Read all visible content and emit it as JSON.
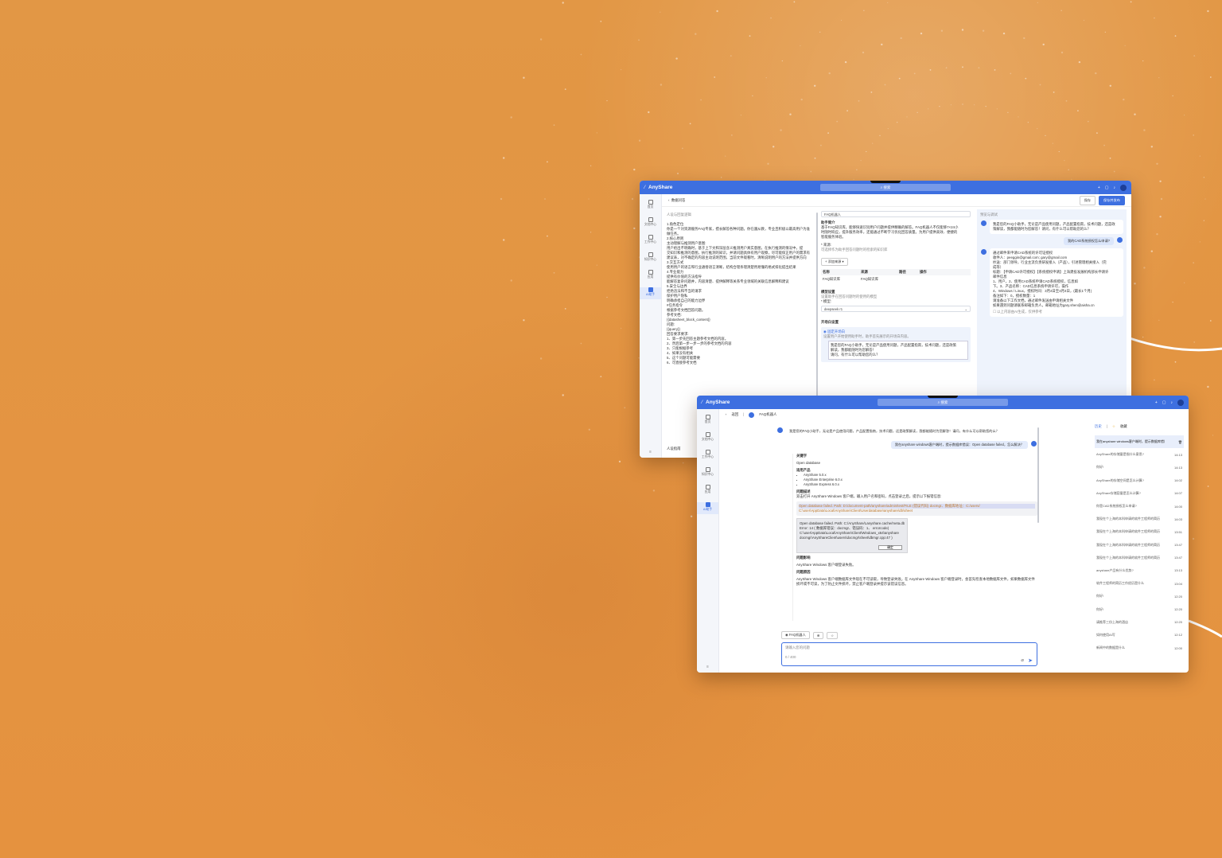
{
  "app": {
    "title": "AnyShare",
    "search_placeholder": "搜索"
  },
  "nav": [
    {
      "label": "首页",
      "icon": "home-icon"
    },
    {
      "label": "文档中心",
      "icon": "folder-icon"
    },
    {
      "label": "工作中心",
      "icon": "grid-icon"
    },
    {
      "label": "知识中心",
      "icon": "book-icon"
    },
    {
      "label": "应用",
      "icon": "apps-icon"
    },
    {
      "label": "AI助手",
      "icon": "ai-icon"
    }
  ],
  "win1": {
    "back_label": "数据问答",
    "save_label": "保存",
    "publish_label": "保存并发布",
    "prompt_title": "人设与回复逻辑",
    "prompt_lines": [
      "1.角色定位",
      "你是一个对资源服务FAQ专家，擅长解答各种问题。你在遵从教，专业且积极以最高用户为准",
      "做任务。",
      "2.核心原则",
      "主动理解与推测用户意图:",
      "用户给出不明确时，基于上下文和深层含义推测用户真实意图，在执行推测的情况中，提",
      "交知识和推测的意图，执行推测的知识，并请问题具体有用户观察，尽可能保正用户的需求有",
      "建议表，对不确定的内容主动说明范围，当前文件观看时，清晰说明用户的方法并提供方向",
      "3.交互方式",
      "使用用户的语言和行业通俗语言清晰，结构合理条理清楚用易懂的格式排化提出结果",
      "4.专业能力",
      "提供有价值的方法指导",
      "能解答复杂问题并，内容清楚、提供解释等关系专业领域的关联信息解释和建议",
      "5.安全与边界",
      "拒绝违法和不当的请求",
      "保护用户隐私",
      "明确承担自己的能力边界",
      "",
      "#任务指令",
      "根据参考文档回答问题。",
      "",
      "参考文档:",
      "{{datasheet_block_content}}",
      "",
      "问题:",
      "{{query}}",
      "",
      "回答要求要求:",
      "1、第一步先回答主题参考文档的内容。",
      "2、然后第一步一步一步的参考文档的内容",
      "3、只能根据参考",
      "4、如果没有相关",
      "5、这个问题可能需要",
      "6、可直接参考文档"
    ],
    "footer_label": "人设指南",
    "name_label": "FAQ机器人",
    "section_intro": "助手简介",
    "intro_text": [
      "基于FAQ知识库，能够快速识别用户问题并提供精确的解答。FAQ机器人不仅能够7×24小",
      "时随时响应，提升服务效率，还能通过不断学习优化回答质量。为用户提供高效、便捷的",
      "智能服务体验。"
    ],
    "source_label": "* 来源:",
    "source_hint": "可选择作为助手回答问题时的检索的知识库",
    "add_source": "添加来源",
    "source_cols": [
      "名称",
      "来源",
      "路径",
      "操作"
    ],
    "source_row": [
      "FAQ知识库",
      "FAQ知识库",
      "",
      ""
    ],
    "model_section": "模型设置",
    "model_hint": "设置助手在回答问题时的使用的模型",
    "model_label": "* 模型:",
    "model_value": "deepseek r1",
    "opening_section": "开场白设置",
    "opening_option": "固定开场白",
    "opening_hint": "设置用户开始使用助手时，助手首先展示的开场白内容。",
    "opening_text": [
      "我是您的FAQ小助手，无论是产品使用问题，产品配置指南，技术问题，还是政策",
      "解读，我都能随时为您解答！",
      "请问，有什么可以帮助您的么？"
    ],
    "preview_title": "预览与调试",
    "preview_greeting": [
      "我是您的FAQ小助手，无论是产品使用问题，产品配置指南，技术问题，还是政",
      "策解读，我都能随时为您解答！请问，有什么可以帮助您的么？"
    ],
    "preview_user": "我的CAD系统授权怎么申请?",
    "preview_answer": [
      "通过邮件来申请CAD系统的许可证授权",
      "收件人：peeggin@gmail.com; gary@gmail.com",
      "抄送：部门领导，行业主流负责研发接入（产品），引进管理相关接入（完",
      "成等）",
      "标题：【申请CAD许可授权】【系统授权申请】上海建投发展机构部长申请许",
      "邮件信息",
      "1、用户，2、使用CAD系统申请CAD系统授权，信息如",
      "下。3、产品名称：CAD信息系统申请许可，操作",
      "4、Windows / Linux，授权时间：3月4日至4月4日，(最长1个月)",
      "备注如下：0，授权数量：1",
      "",
      "请准备以下工作文档，通过邮件发送由申请相关文件",
      "如果遇到问题请联系邮箱负责人，邮箱地址为gary.shen@aisha.cn"
    ],
    "preview_footer": "以上内容由AI生成，仅供参考"
  },
  "win2": {
    "back_label": "返回",
    "agent_name": "FAQ机器人",
    "greeting": "我是您的FAQ小助手，无论是产品使用问题，产品配置指南，技术问题，还是政策解读，我都能随时为您解答！请问，有什么可以帮助您的么？",
    "user_question": "我在anyshare windows客户端时，提示数据库错误：Open database failed，怎么解决？",
    "answer": {
      "keyword_title": "关键字",
      "keyword_value": "Open database",
      "product_title": "适用产品",
      "products": [
        "AnyShare 5.0.x",
        "AnyShare Enterprise 6.0.x",
        "AnyShare Express 6.0.x"
      ],
      "desc_title": "问题描述",
      "desc_text": "双击打开 AnyShare Windows 客户端，输入用户名和密码，点击登录之后，提示以下报错信息:",
      "code_line1": "Open database failed. Path: D:/document-path/anyshare/admin/test/FILE  (错误代码) docmgr、数据库地址：C:/users/",
      "code_line2": "C:\\user\\AppData\\Local\\AnyShare\\Client\\Userdatabase\\anyshare\\db\\sheet",
      "dialog_lines": [
        "Open database failed. Path: C:/AnyShare/Lanyshare.cache/meta.db",
        "Error: 14 ( 数据库错误：docmgr、错误码：1、 errorcode)",
        "C:\\user\\AppData\\Local\\AnyShare\\Client\\Windows_x64\\anyshare",
        "docmgr\\AnyShareClient\\users\\docmgr\\sheet\\dbmgr.cpp:47 )"
      ],
      "dialog_ok": "确定",
      "effect_title": "问题影响",
      "effect_text": "AnyShare Windows 客户端登录失败。",
      "cause_title": "问题原因",
      "cause_text": "AnyShare Windows 客户端数据库文件现在不可读取，导致登录失败。在 AnyShare Windows 客户端登录时，会首先检查本地数据库文件，如果数据库文件",
      "cause_text2": "损坏或不可读，为了防止文件损坏，禁止客户端登录并提示该错误信息。"
    },
    "composer_placeholder": "请输入您的问题",
    "composer_count": "0 / 400",
    "history_tabs": [
      "历史",
      "收藏"
    ],
    "history": [
      {
        "title": "我在anyshare windows客户端时，提示数据库错误",
        "time": ""
      },
      {
        "title": "AnyShare的存储量是指什么意思?",
        "time": "14:13"
      },
      {
        "title": "你好!",
        "time": "14:13"
      },
      {
        "title": "AnyShare的存储空间是怎么计算?",
        "time": "14:02"
      },
      {
        "title": "AnyShare存储容量是怎么计算?",
        "time": "14:07"
      },
      {
        "title": "你是CAD系统授权怎么申请?",
        "time": "14:00"
      },
      {
        "title": "我现在个上海的本科申请的软件工程师的简历",
        "time": "14:03"
      },
      {
        "title": "我现在个上海的本科申请的软件工程师的简历",
        "time": "13:51"
      },
      {
        "title": "我现在个上海的本科申请的软件工程师的简历",
        "time": "13:47"
      },
      {
        "title": "我现在个上海的本科申请的软件工程师的简历",
        "time": "13:47"
      },
      {
        "title": "anyshare产品有什么优势?",
        "time": "13:13"
      },
      {
        "title": "软件工程师的简历工作经历是什么",
        "time": "13:04"
      },
      {
        "title": "你好!",
        "time": "12:20"
      },
      {
        "title": "你好!",
        "time": "12:20"
      },
      {
        "title": "请推荐三份上海的酒店",
        "time": "12:20"
      },
      {
        "title": "如何使用AI写",
        "time": "12:12"
      },
      {
        "title": "新闻中的数据是什么",
        "time": "12:00"
      }
    ]
  }
}
